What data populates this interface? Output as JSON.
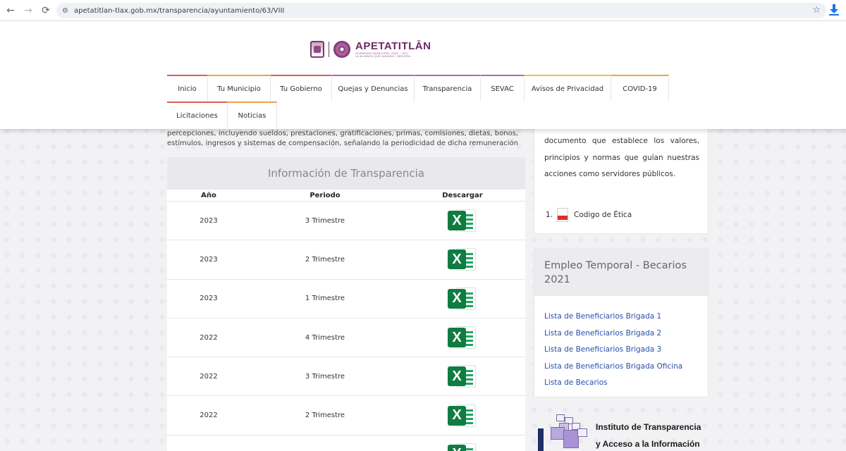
{
  "browser": {
    "back": "←",
    "forward": "→",
    "reload": "⟳",
    "url": "apetatitlan-tlax.gob.mx/transparencia/ayuntamiento/63/VIII",
    "star": "☆"
  },
  "logo": {
    "name": "APETATITLĀN",
    "line1": "GOBIERNO MUNICIPAL 2024 - 2027",
    "line2": "LA ALIANZA QUE AVANZA Y MEJORA"
  },
  "menu": {
    "row1": [
      {
        "label": "Inicio",
        "color": "#e05a5a",
        "w": 58
      },
      {
        "label": "Tu Municipio",
        "color": "#f0a04b",
        "w": 89
      },
      {
        "label": "Tu Gobierno",
        "color": "#e05a5a",
        "w": 87
      },
      {
        "label": "Quejas y Denuncias",
        "color": "#a36cc8",
        "w": 117
      },
      {
        "label": "Transparencia",
        "color": "#a36cc8",
        "w": 94
      },
      {
        "label": "SEVAC",
        "color": "#a36cc8",
        "w": 62
      },
      {
        "label": "Avisos de Privacidad",
        "color": "#f0c040",
        "w": 123
      },
      {
        "label": "COVID-19",
        "color": "#f0a04b",
        "w": 82
      }
    ],
    "row2": [
      {
        "label": "Licitaciones",
        "color": "#e05a5a",
        "w": 86
      },
      {
        "label": "Noticias",
        "color": "#f0a04b",
        "w": 70
      }
    ]
  },
  "main": {
    "intro": "percepciones, incluyendo sueldos, prestaciones, gratificaciones, primas, comisiones, dietas, bonos, estímulos, ingresos y sistemas de compensación, señalando la periodicidad de dicha remuneración",
    "panel_title": "Información de Transparencia",
    "headers": {
      "year": "Año",
      "period": "Periodo",
      "download": "Descargar"
    },
    "rows": [
      {
        "year": "2023",
        "period": "3 Trimestre"
      },
      {
        "year": "2023",
        "period": "2 Trimestre"
      },
      {
        "year": "2023",
        "period": "1 Trimestre"
      },
      {
        "year": "2022",
        "period": "4 Trimestre"
      },
      {
        "year": "2022",
        "period": "3 Trimestre"
      },
      {
        "year": "2022",
        "period": "2 Trimestre"
      },
      {
        "year": "",
        "period": ""
      }
    ]
  },
  "sidebar": {
    "ethics_text": "documento que establece los valores, principios y normas que guían nuestras acciones como servidores públicos.",
    "ethics_link_num": "1.",
    "ethics_link": "Codigo de Ética",
    "card2_title": "Empleo Temporal - Becarios 2021",
    "links": [
      "Lista de Beneficiarios Brigada 1",
      "Lista de Beneficiarios Brigada 2",
      "Lista de Beneficiarios Brigada 3",
      "Lista de Beneficiarios Brigada Oficina",
      "Lista de Becarios"
    ],
    "institute_line1": "Instituto de Transparencia",
    "institute_line2": "y Acceso a la Información"
  }
}
